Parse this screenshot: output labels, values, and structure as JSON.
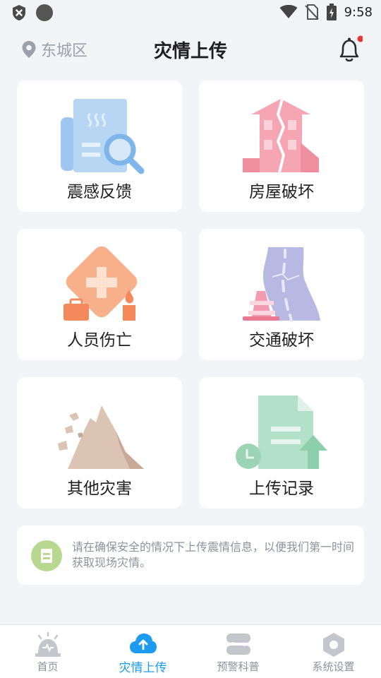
{
  "status_bar": {
    "time": "9:58"
  },
  "header": {
    "location": "东城区",
    "title": "灾情上传"
  },
  "cards": [
    {
      "label": "震感反馈"
    },
    {
      "label": "房屋破坏"
    },
    {
      "label": "人员伤亡"
    },
    {
      "label": "交通破坏"
    },
    {
      "label": "其他灾害"
    },
    {
      "label": "上传记录"
    }
  ],
  "notice": {
    "text": "请在确保安全的情况下上传震情信息，以便我们第一时间获取现场灾情。"
  },
  "tabbar": {
    "tabs": [
      {
        "label": "首页",
        "icon": "siren-icon"
      },
      {
        "label": "灾情上传",
        "icon": "cloud-upload-icon",
        "active": true
      },
      {
        "label": "预警科普",
        "icon": "layers-icon"
      },
      {
        "label": "系统设置",
        "icon": "hexagon-settings-icon"
      }
    ]
  },
  "colors": {
    "accent": "#1c9bf0",
    "background": "#f3f4f8",
    "notification_dot": "#e53935"
  }
}
